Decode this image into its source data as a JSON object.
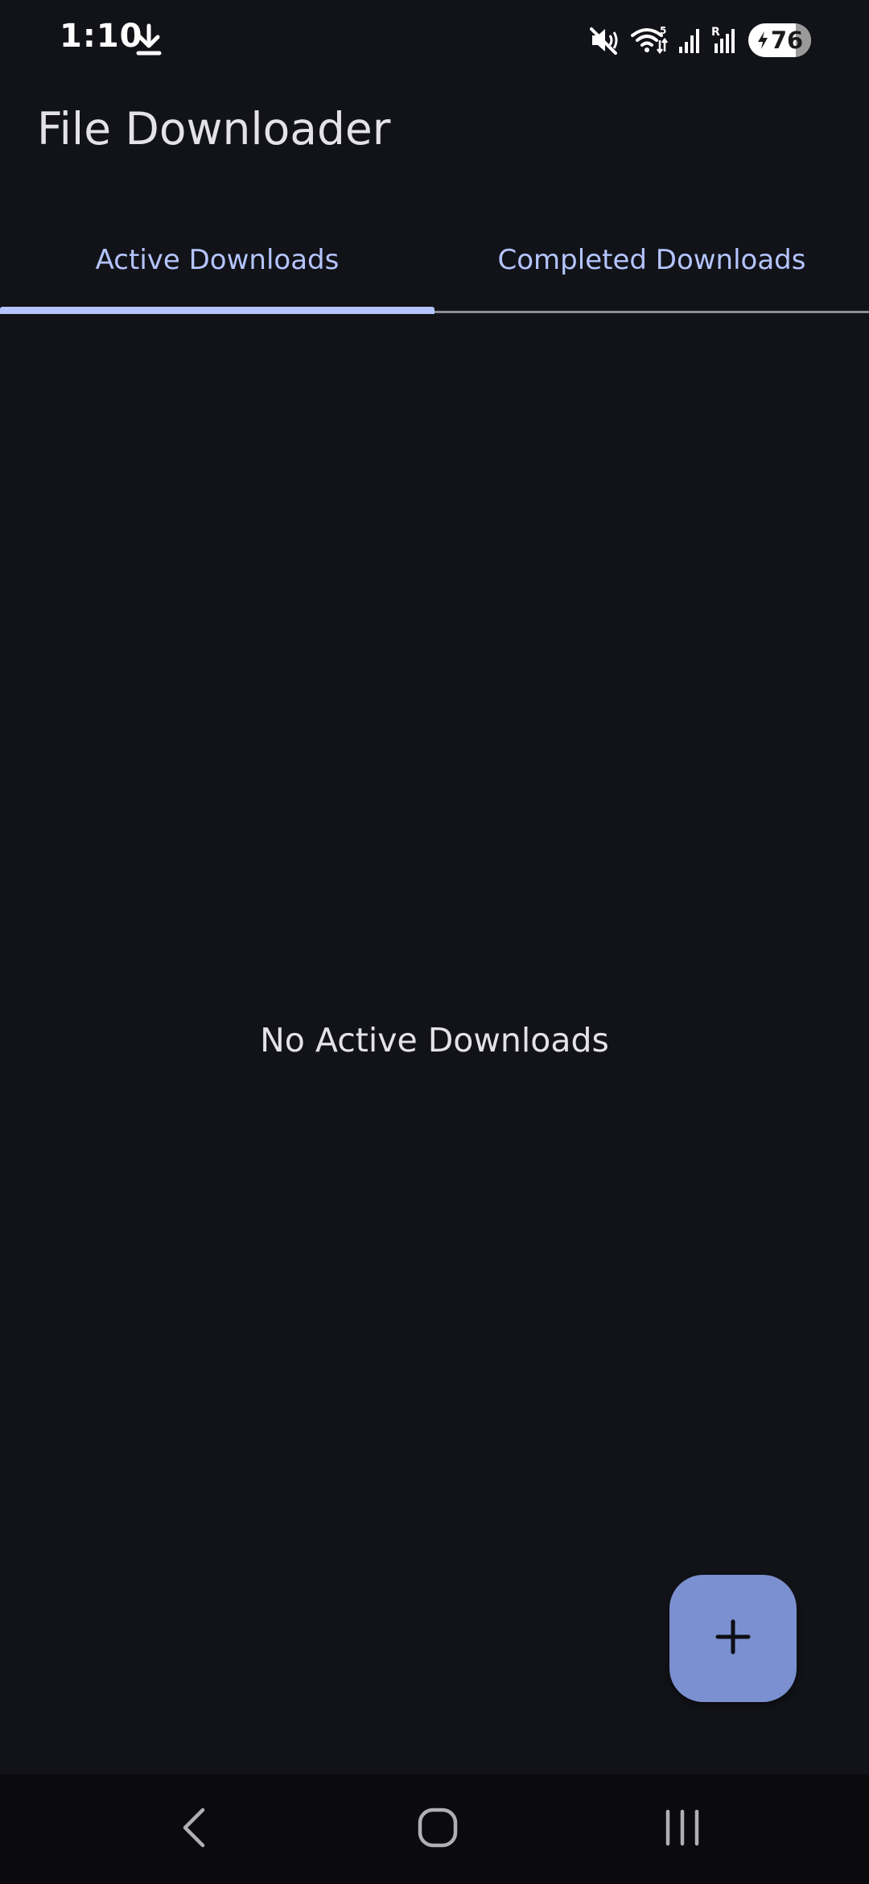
{
  "status_bar": {
    "time": "1:10",
    "battery_level": "76",
    "battery_fraction": 0.76,
    "icons": [
      "download-icon",
      "mute-icon",
      "wifi-icon",
      "signal-icon",
      "signal-roaming-icon",
      "battery-charging-icon"
    ]
  },
  "app": {
    "title": "File Downloader"
  },
  "tabs": [
    {
      "label": "Active Downloads",
      "selected": true
    },
    {
      "label": "Completed Downloads",
      "selected": false
    }
  ],
  "empty_state": {
    "message": "No Active Downloads"
  },
  "fab": {
    "icon": "plus-icon"
  },
  "nav_bar": {
    "buttons": [
      "back-icon",
      "home-icon",
      "recents-icon"
    ]
  },
  "colors": {
    "background": "#121318",
    "accent": "#b4c4ff",
    "fab": "#7b90d0",
    "text": "#e3e2e9",
    "nav_background": "#0b0b0d"
  }
}
